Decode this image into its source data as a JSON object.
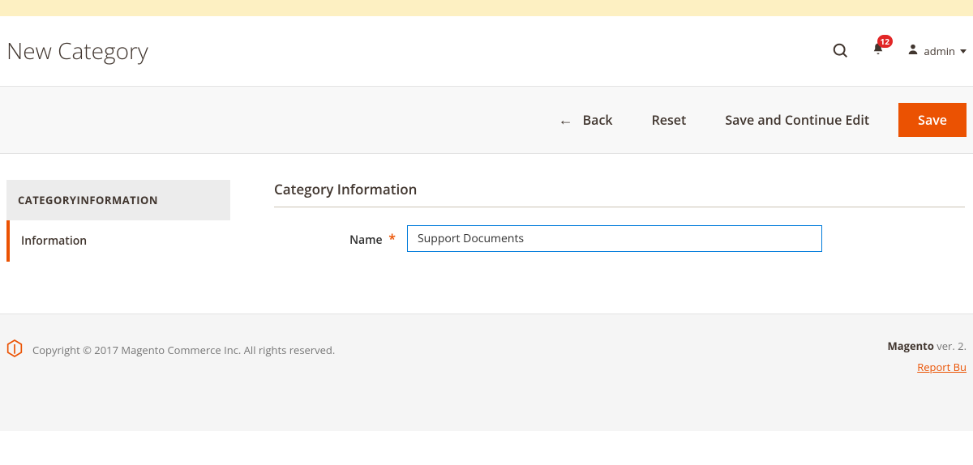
{
  "header": {
    "page_title": "New Category",
    "notifications_count": "12",
    "user_name": "admin"
  },
  "actions": {
    "back": "Back",
    "reset": "Reset",
    "save_continue": "Save and Continue Edit",
    "save": "Save"
  },
  "sidebar": {
    "heading": "CATEGORYINFORMATION",
    "items": [
      {
        "label": "Information"
      }
    ]
  },
  "form": {
    "section_title": "Category Information",
    "name_label": "Name",
    "required_mark": "*",
    "name_value": "Support Documents"
  },
  "footer": {
    "copyright": "Copyright © 2017 Magento Commerce Inc. All rights reserved.",
    "brand": "Magento",
    "version_text": " ver. 2.",
    "report_link": "Report Bu"
  }
}
